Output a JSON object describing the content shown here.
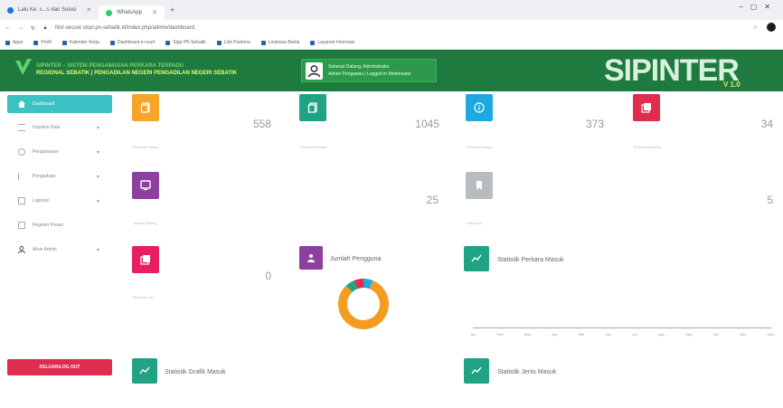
{
  "browser": {
    "tabs": [
      {
        "label": "Lalu Ke. s...s dan Solusi",
        "color": "#1a73e8",
        "active": false
      },
      {
        "label": "WhatsApp",
        "color": "#25d366",
        "active": true
      }
    ],
    "new_tab": "+",
    "url": "Not secure  sispi.pn-sebatik.id/index.php/admin/dashboard",
    "bookmarks": [
      "Apps",
      "Profil",
      "Kalender Kerja",
      "Dashboard e-court",
      "Sipp PN Sebatik",
      "Link Panitera",
      "Linimasa Berita",
      "Layanan Informasi"
    ]
  },
  "header": {
    "title_line1": "SIPINTER – SISTEM PENGAWASAN PERKARA TERPADU",
    "title_line2": "REGIONAL SEBATIK | PENGADILAN NEGERI PENGADILAN NEGERI SEBATIK",
    "user_line1": "Selamat Datang, Administrator",
    "user_line2": "Admin Pengawas | Logged in Webmaster",
    "brand": "SIPINTER",
    "brand_sub": "V 1.0"
  },
  "sidebar": {
    "items": [
      {
        "label": "Dashboard",
        "icon": "home-icon",
        "active": true,
        "chevron": false
      },
      {
        "label": "Inspeksi Data",
        "icon": "list-icon",
        "active": false,
        "chevron": true
      },
      {
        "label": "Pengawasan",
        "icon": "eye-icon",
        "active": false,
        "chevron": true
      },
      {
        "label": "Pengaduan",
        "icon": "flag-icon",
        "active": false,
        "chevron": true
      },
      {
        "label": "Laporan",
        "icon": "file-icon",
        "active": false,
        "chevron": true
      },
      {
        "label": "Register Pesan",
        "icon": "book-icon",
        "active": false,
        "chevron": false
      },
      {
        "label": "Akun Admin",
        "icon": "user-icon",
        "active": false,
        "chevron": true
      }
    ],
    "logout": "KELUAR/LOG OUT"
  },
  "cards": [
    {
      "value": "558",
      "label": "Perkara Pidana",
      "color": "#f5a52a",
      "icon": "copy-icon"
    },
    {
      "value": "1045",
      "label": "Perkara Perdata",
      "color": "#1fa384",
      "icon": "copy-icon"
    },
    {
      "value": "373",
      "label": "Perkara Sidang",
      "color": "#1ea8e0",
      "icon": "info-icon"
    },
    {
      "value": "34",
      "label": "Perkara Banding",
      "color": "#e02c4f",
      "icon": "docs-icon"
    },
    {
      "value": "",
      "label": "Jadwal Sidang",
      "color": "#8e3fa0",
      "icon": "monitor-icon"
    },
    {
      "value": "25",
      "label": "",
      "color": "",
      "icon": ""
    },
    {
      "value": "",
      "label": "Saksi Ahli",
      "color": "#b7bcc0",
      "icon": "bookmark-icon"
    },
    {
      "value": "5",
      "label": "",
      "color": "",
      "icon": ""
    },
    {
      "value": "0",
      "label": "Perkara Lain",
      "color": "#e81e63",
      "icon": "docs-icon"
    }
  ],
  "sections": {
    "pengguna": "Jumlah Pengguna",
    "perkara_masuk": "Statistik Perkara Masuk",
    "grafik": "Statistik Grafik Masuk",
    "jenis": "Statistik Jenis Masuk"
  },
  "chart_data": {
    "type": "pie",
    "title": "Jumlah Pengguna",
    "slices": [
      {
        "value": 82,
        "color": "#f39c1f"
      },
      {
        "value": 6,
        "color": "#1fa384"
      },
      {
        "value": 6,
        "color": "#e02c4f"
      },
      {
        "value": 6,
        "color": "#1ea8e0"
      }
    ]
  },
  "line_chart": {
    "months": [
      "Jan",
      "Feb",
      "Mar",
      "Apr",
      "Mei",
      "Jun",
      "Jul",
      "Agu",
      "Sep",
      "Okt",
      "Nov",
      "Des"
    ]
  }
}
